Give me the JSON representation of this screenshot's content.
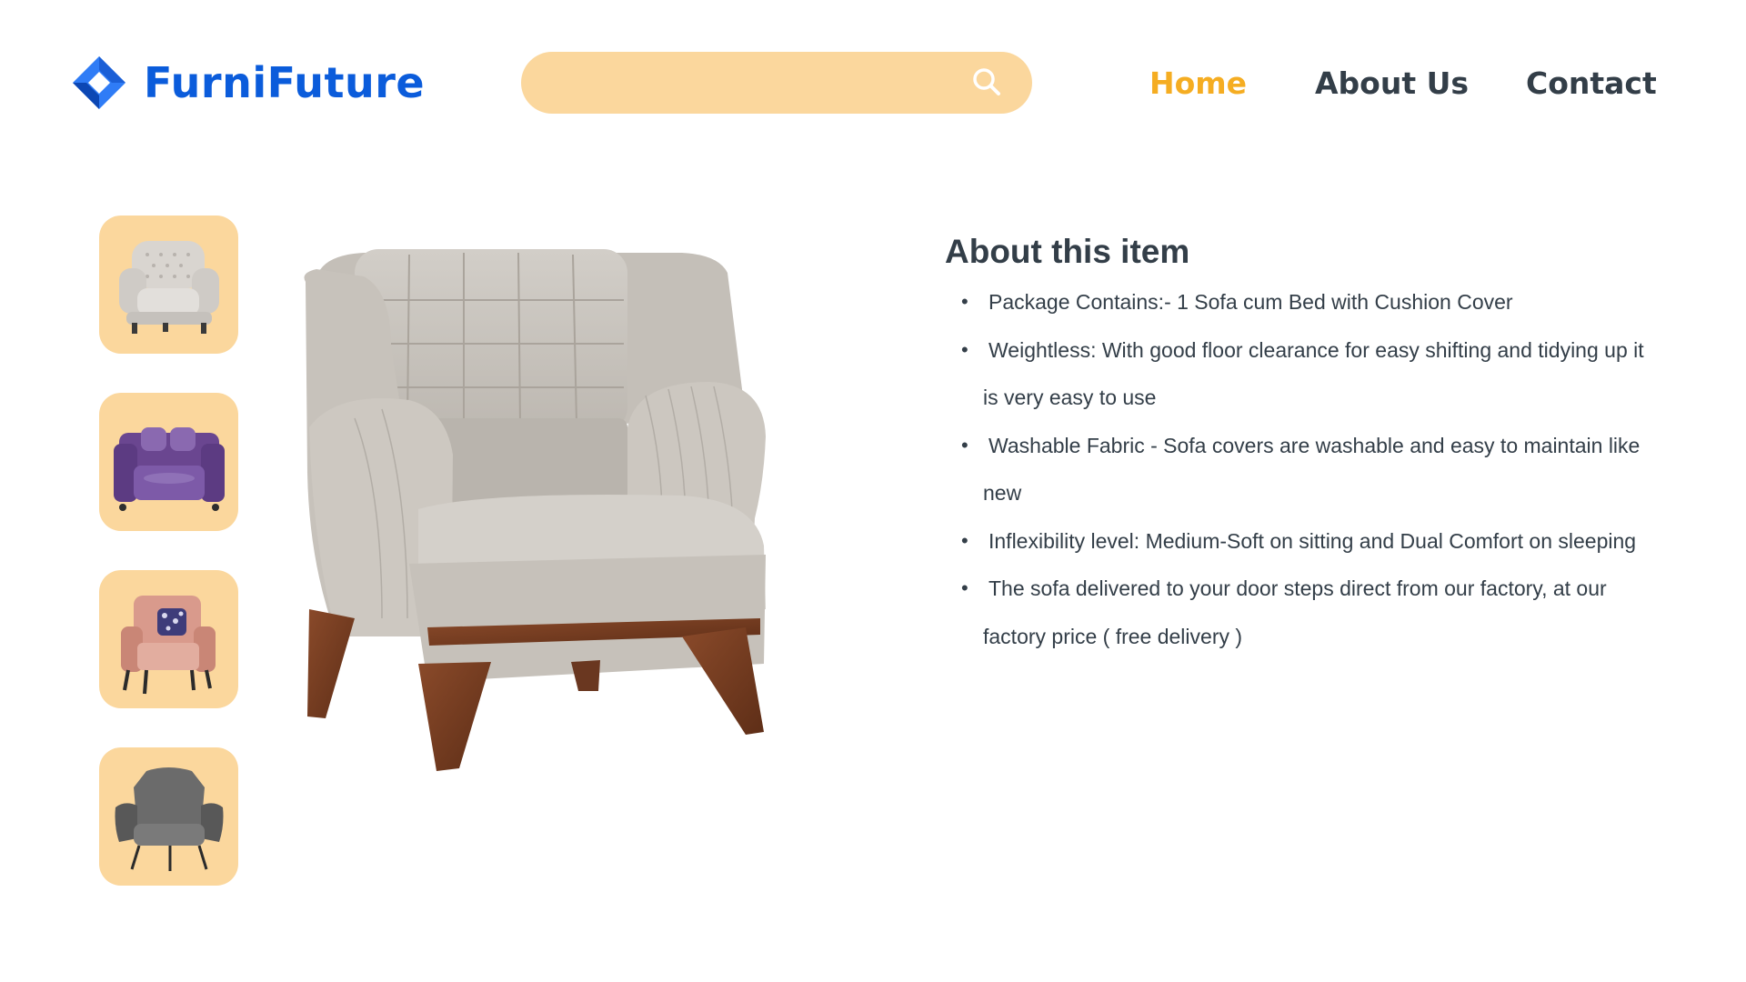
{
  "brand": {
    "name": "FurniFuture",
    "logo_icon": "diamond-logo-icon",
    "color": "#0b5cdb"
  },
  "search": {
    "value": "",
    "placeholder": "",
    "icon": "search-icon",
    "background": "#fbd79d"
  },
  "nav": {
    "items": [
      {
        "label": "Home",
        "active": true
      },
      {
        "label": "About Us",
        "active": false
      },
      {
        "label": "Contact",
        "active": false
      }
    ],
    "active_color": "#f5ad22",
    "color": "#333e48"
  },
  "thumbnails": [
    {
      "name": "white-tufted-armchair"
    },
    {
      "name": "purple-velvet-armchair"
    },
    {
      "name": "pink-armchair-with-cushion"
    },
    {
      "name": "grey-wingback-chair"
    }
  ],
  "product_image": {
    "name": "beige-sofa-cum-bed-armchair"
  },
  "about": {
    "title": "About this item",
    "features": [
      "Package Contains:- 1 Sofa cum Bed with Cushion Cover",
      "Weightless: With good floor clearance for easy shifting and tidying up it is very easy to use",
      "Washable Fabric - Sofa covers are washable and easy to maintain like new",
      "Inflexibility level: Medium-Soft on sitting and Dual Comfort on sleeping",
      "The sofa delivered to your door steps direct from our factory, at our factory price ( free delivery )"
    ]
  }
}
